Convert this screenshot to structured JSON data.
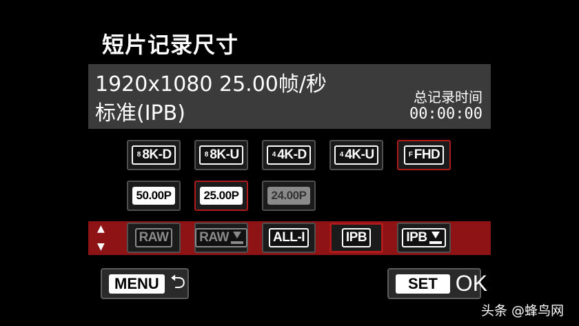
{
  "title": "短片记录尺寸",
  "info": {
    "resolution_line": "1920x1080 25.00帧/秒",
    "compression_line": "标准(IPB)",
    "total_label": "总记录时间",
    "total_time": "00:00:00"
  },
  "size_options": [
    {
      "mark": "8",
      "label": "8K-D",
      "state": "normal"
    },
    {
      "mark": "8",
      "label": "8K-U",
      "state": "normal"
    },
    {
      "mark": "4",
      "label": "4K-D",
      "state": "normal"
    },
    {
      "mark": "4",
      "label": "4K-U",
      "state": "normal"
    },
    {
      "mark": "F",
      "label": "FHD",
      "state": "selected"
    }
  ],
  "frame_options": [
    {
      "label": "50.00P",
      "state": "normal"
    },
    {
      "label": "25.00P",
      "state": "selected"
    },
    {
      "label": "24.00P",
      "state": "disabled"
    }
  ],
  "compression_options": [
    {
      "label": "RAW",
      "state": "disabled"
    },
    {
      "label": "RAW",
      "state": "disabled"
    },
    {
      "label": "ALL-I",
      "state": "normal"
    },
    {
      "label": "IPB",
      "state": "selected"
    },
    {
      "label": "IPB",
      "state": "normal"
    }
  ],
  "nav": {
    "up": "▲",
    "down": "▼"
  },
  "footer": {
    "menu_label": "MENU",
    "return_icon": "return-arrow-icon",
    "set_label": "SET",
    "ok_label": "OK"
  },
  "watermark": "头条 @蜂鸟网",
  "colors": {
    "accent": "#8d1315",
    "panel": "#3b3b3b",
    "selected_border": "#b01a1a"
  }
}
